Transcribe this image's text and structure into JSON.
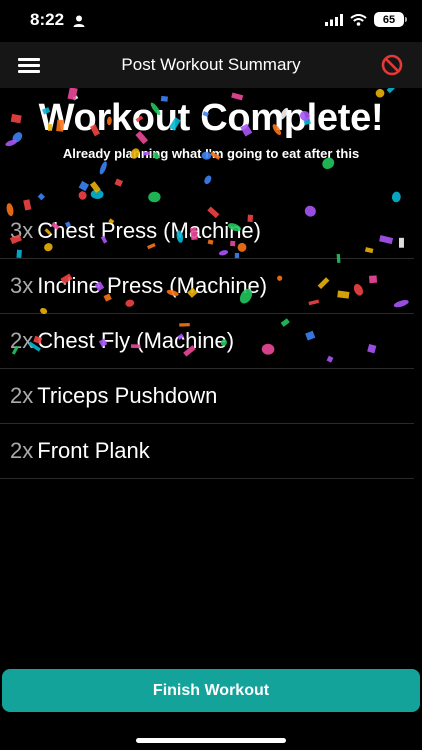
{
  "status_bar": {
    "time": "8:22",
    "battery": "65"
  },
  "nav": {
    "title": "Post Workout Summary"
  },
  "headline": "Workout Complete!",
  "subtitle": "Already planning what I'm going to eat after this",
  "exercises": [
    {
      "count": "3x",
      "name": "Chest Press (Machine)"
    },
    {
      "count": "3x",
      "name": "Incline Press (Machine)"
    },
    {
      "count": "2x",
      "name": "Chest Fly (Machine)"
    },
    {
      "count": "2x",
      "name": "Triceps Pushdown"
    },
    {
      "count": "2x",
      "name": "Front Plank"
    }
  ],
  "finish_button": "Finish Workout",
  "colors": {
    "accent": "#14a39a",
    "discard_icon": "#e53935",
    "confetti": [
      "#3b82f6",
      "#22c55e",
      "#ef4444",
      "#a855f7",
      "#f97316",
      "#eab308",
      "#ec4899",
      "#f5f5f5",
      "#06b6d4"
    ]
  },
  "icons": {
    "menu": "hamburger-menu-icon",
    "discard": "no-entry-icon",
    "person": "person-icon",
    "signal": "signal-icon",
    "wifi": "wifi-icon"
  }
}
